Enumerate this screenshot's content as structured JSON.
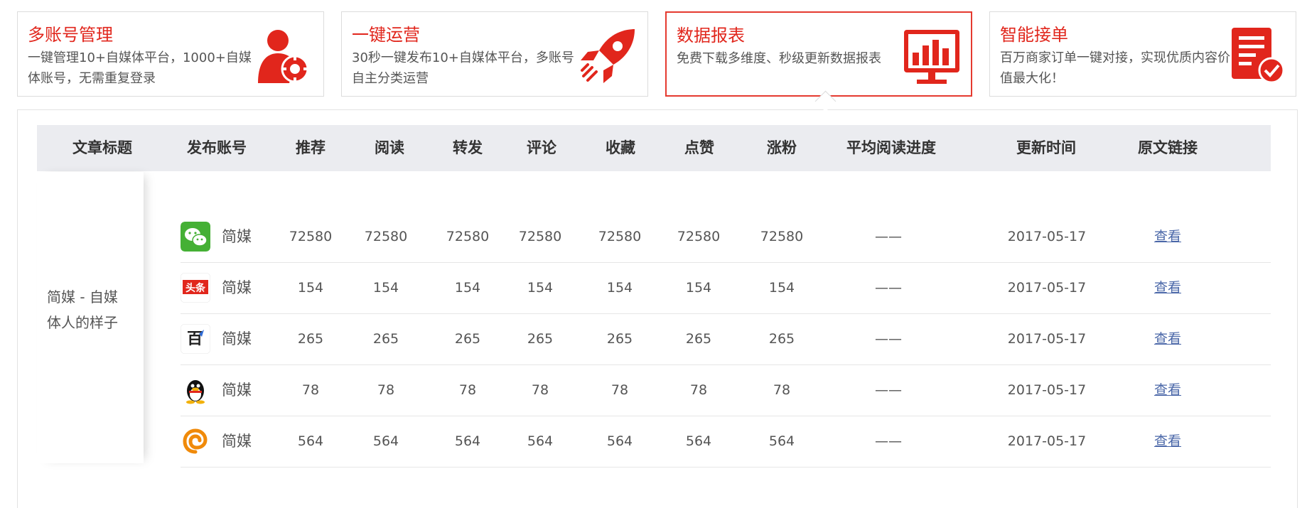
{
  "features": [
    {
      "title": "多账号管理",
      "desc": "一键管理10+自媒体平台，1000+自媒体账号，无需重复登录",
      "icon": "user-gear-icon",
      "active": false
    },
    {
      "title": "一键运营",
      "desc": "30秒一键发布10+自媒体平台，多账号自主分类运营",
      "icon": "rocket-icon",
      "active": false
    },
    {
      "title": "数据报表",
      "desc": "免费下载多维度、秒级更新数据报表",
      "icon": "bar-chart-monitor-icon",
      "active": true
    },
    {
      "title": "智能接单",
      "desc": "百万商家订单一键对接，实现优质内容价值最大化！",
      "icon": "order-check-icon",
      "active": false
    }
  ],
  "table": {
    "headers": [
      "文章标题",
      "发布账号",
      "推荐",
      "阅读",
      "转发",
      "评论",
      "收藏",
      "点赞",
      "涨粉",
      "平均阅读进度",
      "更新时间",
      "原文链接"
    ],
    "article_title": "简媒 - 自媒体人的样子",
    "rows": [
      {
        "platform_icon": "wechat-icon",
        "account": "简媒",
        "values": [
          "72580",
          "72580",
          "72580",
          "72580",
          "72580",
          "72580",
          "72580"
        ],
        "progress": "——",
        "updated": "2017-05-17",
        "link": "查看"
      },
      {
        "platform_icon": "toutiao-icon",
        "account": "简媒",
        "values": [
          "154",
          "154",
          "154",
          "154",
          "154",
          "154",
          "154"
        ],
        "progress": "——",
        "updated": "2017-05-17",
        "link": "查看"
      },
      {
        "platform_icon": "baidu-baijia-icon",
        "account": "简媒",
        "values": [
          "265",
          "265",
          "265",
          "265",
          "265",
          "265",
          "265"
        ],
        "progress": "——",
        "updated": "2017-05-17",
        "link": "查看"
      },
      {
        "platform_icon": "qq-penguin-icon",
        "account": "简媒",
        "values": [
          "78",
          "78",
          "78",
          "78",
          "78",
          "78",
          "78"
        ],
        "progress": "——",
        "updated": "2017-05-17",
        "link": "查看"
      },
      {
        "platform_icon": "sohu-spiral-icon",
        "account": "简媒",
        "values": [
          "564",
          "564",
          "564",
          "564",
          "564",
          "564",
          "564"
        ],
        "progress": "——",
        "updated": "2017-05-17",
        "link": "查看"
      }
    ]
  },
  "colors": {
    "brand_red": "#e1261c",
    "active_border": "#e53a2f",
    "header_bg": "#ebecf0",
    "link": "#4a67a8"
  }
}
